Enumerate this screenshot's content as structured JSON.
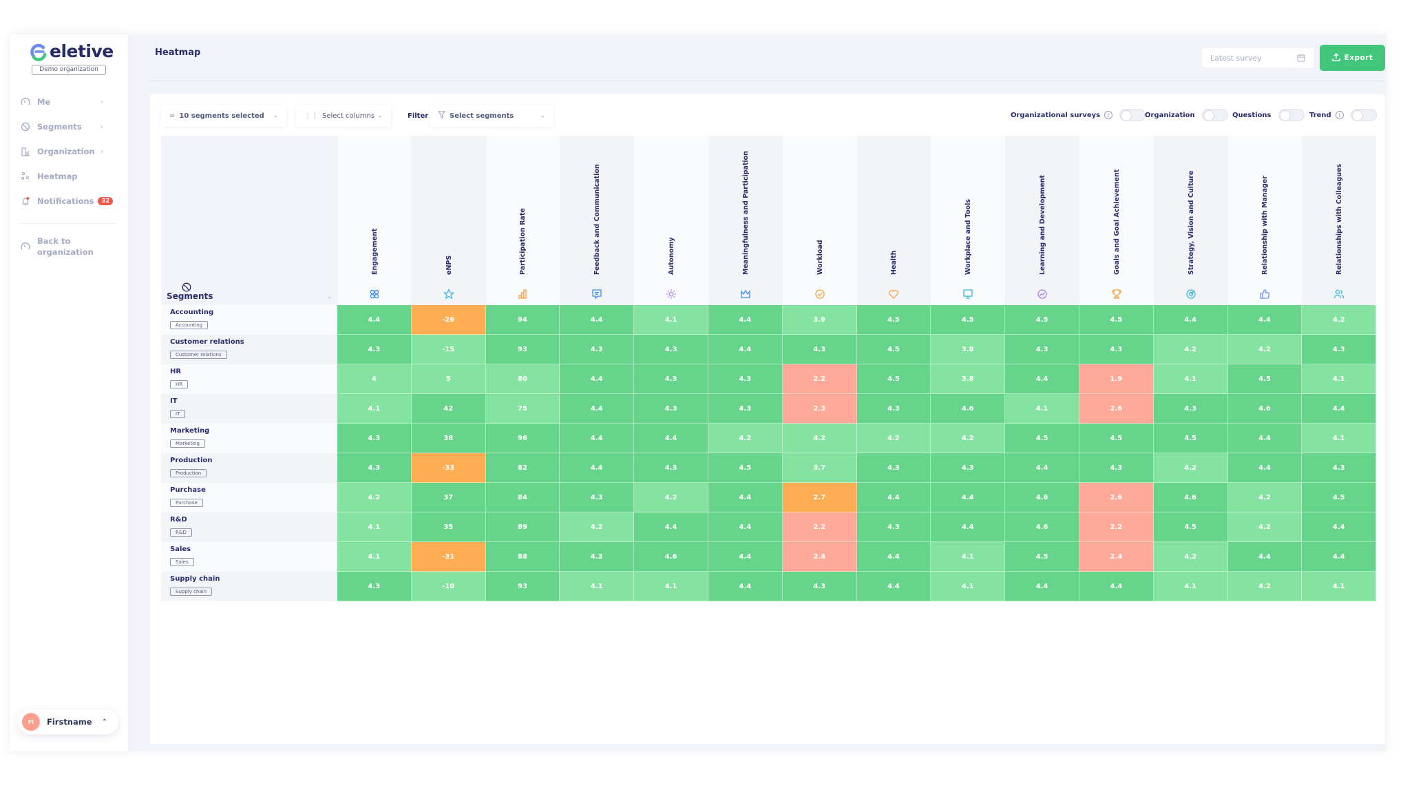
{
  "sidebar": {
    "brand": "eletive",
    "organization": "Demo organization",
    "items": [
      {
        "label": "Me",
        "icon": "gauge-icon",
        "has_chevron": true
      },
      {
        "label": "Segments",
        "icon": "pie-chart-icon",
        "has_chevron": true
      },
      {
        "label": "Organization",
        "icon": "building-chart-icon",
        "has_chevron": true
      },
      {
        "label": "Heatmap",
        "icon": "dots-icon",
        "has_chevron": false
      },
      {
        "label": "Notifications",
        "icon": "bell-icon",
        "has_chevron": false,
        "badge": "32"
      }
    ],
    "back_line1": "Back to",
    "back_line2": "organization",
    "user": {
      "initials": "FI",
      "name": "Firstname"
    }
  },
  "header": {
    "title": "Heatmap",
    "survey_placeholder": "Latest survey",
    "export_label": "Export"
  },
  "toolbar": {
    "segments_selected": "10 segments selected",
    "select_columns": "Select columns",
    "filter_label": "Filter",
    "select_segments": "Select segments",
    "toggles": [
      {
        "label": "Organizational surveys",
        "info": true,
        "on": false
      },
      {
        "label": "Organization",
        "info": false,
        "on": false
      },
      {
        "label": "Questions",
        "info": false,
        "on": false
      },
      {
        "label": "Trend",
        "info": true,
        "on": false
      }
    ]
  },
  "colors": {
    "high": "#66d48a",
    "mid": "#84e3a0",
    "warn": "#ffad52",
    "low": "#ffa999",
    "accent": "#41c67c",
    "text": "#2a2d6b"
  },
  "chart_data": {
    "type": "heatmap",
    "title": "Heatmap",
    "row_header": "Segments",
    "columns": [
      {
        "label": "Engagement",
        "icon": "engagement-icon"
      },
      {
        "label": "eNPS",
        "icon": "star-icon"
      },
      {
        "label": "Participation Rate",
        "icon": "bar-chart-icon"
      },
      {
        "label": "Feedback and Communication",
        "icon": "chat-icon"
      },
      {
        "label": "Autonomy",
        "icon": "sun-icon"
      },
      {
        "label": "Meaningfulness and Participation",
        "icon": "crown-icon"
      },
      {
        "label": "Workload",
        "icon": "check-circle-icon"
      },
      {
        "label": "Health",
        "icon": "heart-icon"
      },
      {
        "label": "Workplace and Tools",
        "icon": "monitor-icon"
      },
      {
        "label": "Learning and Development",
        "icon": "trend-circle-icon"
      },
      {
        "label": "Goals and Goal Achievement",
        "icon": "trophy-icon"
      },
      {
        "label": "Strategy, Vision and Culture",
        "icon": "target-icon"
      },
      {
        "label": "Relationship with Manager",
        "icon": "thumbs-up-icon"
      },
      {
        "label": "Relationships with Colleagues",
        "icon": "people-icon"
      }
    ],
    "rows": [
      {
        "segment": "Accounting",
        "tag": "Accounting",
        "values": [
          "4.4",
          "-26",
          "94",
          "4.4",
          "4.1",
          "4.4",
          "3.9",
          "4.5",
          "4.5",
          "4.5",
          "4.5",
          "4.4",
          "4.4",
          "4.2"
        ],
        "levels": [
          "high",
          "warn",
          "high",
          "high",
          "mid",
          "high",
          "mid",
          "high",
          "high",
          "high",
          "high",
          "high",
          "high",
          "mid"
        ]
      },
      {
        "segment": "Customer relations",
        "tag": "Customer relations",
        "values": [
          "4.3",
          "-15",
          "93",
          "4.3",
          "4.3",
          "4.4",
          "4.3",
          "4.5",
          "3.8",
          "4.3",
          "4.3",
          "4.2",
          "4.2",
          "4.3"
        ],
        "levels": [
          "high",
          "mid",
          "high",
          "high",
          "high",
          "high",
          "high",
          "high",
          "mid",
          "high",
          "high",
          "mid",
          "mid",
          "high"
        ]
      },
      {
        "segment": "HR",
        "tag": "HR",
        "values": [
          "4",
          "5",
          "80",
          "4.4",
          "4.3",
          "4.3",
          "2.2",
          "4.5",
          "3.8",
          "4.4",
          "1.9",
          "4.1",
          "4.5",
          "4.1"
        ],
        "levels": [
          "mid",
          "mid",
          "mid",
          "high",
          "high",
          "high",
          "low",
          "high",
          "mid",
          "high",
          "low",
          "mid",
          "high",
          "mid"
        ]
      },
      {
        "segment": "IT",
        "tag": "IT",
        "values": [
          "4.1",
          "42",
          "75",
          "4.4",
          "4.3",
          "4.3",
          "2.3",
          "4.3",
          "4.6",
          "4.1",
          "2.6",
          "4.3",
          "4.6",
          "4.4"
        ],
        "levels": [
          "mid",
          "high",
          "mid",
          "high",
          "high",
          "high",
          "low",
          "high",
          "high",
          "mid",
          "low",
          "high",
          "high",
          "high"
        ]
      },
      {
        "segment": "Marketing",
        "tag": "Marketing",
        "values": [
          "4.3",
          "38",
          "96",
          "4.4",
          "4.4",
          "4.2",
          "4.2",
          "4.2",
          "4.2",
          "4.5",
          "4.5",
          "4.5",
          "4.4",
          "4.1"
        ],
        "levels": [
          "high",
          "high",
          "high",
          "high",
          "high",
          "mid",
          "mid",
          "mid",
          "mid",
          "high",
          "high",
          "high",
          "high",
          "mid"
        ]
      },
      {
        "segment": "Production",
        "tag": "Production",
        "values": [
          "4.3",
          "-33",
          "82",
          "4.4",
          "4.3",
          "4.5",
          "3.7",
          "4.3",
          "4.3",
          "4.4",
          "4.3",
          "4.2",
          "4.4",
          "4.3"
        ],
        "levels": [
          "high",
          "warn",
          "high",
          "high",
          "high",
          "high",
          "mid",
          "high",
          "high",
          "high",
          "high",
          "mid",
          "high",
          "high"
        ]
      },
      {
        "segment": "Purchase",
        "tag": "Purchase",
        "values": [
          "4.2",
          "37",
          "84",
          "4.3",
          "4.2",
          "4.4",
          "2.7",
          "4.4",
          "4.4",
          "4.6",
          "2.6",
          "4.6",
          "4.2",
          "4.5"
        ],
        "levels": [
          "mid",
          "high",
          "high",
          "high",
          "mid",
          "high",
          "warn",
          "high",
          "high",
          "high",
          "low",
          "high",
          "mid",
          "high"
        ]
      },
      {
        "segment": "R&D",
        "tag": "R&D",
        "values": [
          "4.1",
          "35",
          "89",
          "4.2",
          "4.4",
          "4.4",
          "2.2",
          "4.3",
          "4.4",
          "4.6",
          "2.2",
          "4.5",
          "4.2",
          "4.4"
        ],
        "levels": [
          "mid",
          "high",
          "high",
          "mid",
          "high",
          "high",
          "low",
          "high",
          "high",
          "high",
          "low",
          "high",
          "mid",
          "high"
        ]
      },
      {
        "segment": "Sales",
        "tag": "Sales",
        "values": [
          "4.1",
          "-31",
          "88",
          "4.3",
          "4.6",
          "4.4",
          "2.4",
          "4.4",
          "4.1",
          "4.5",
          "2.4",
          "4.2",
          "4.4",
          "4.4"
        ],
        "levels": [
          "mid",
          "warn",
          "high",
          "high",
          "high",
          "high",
          "low",
          "high",
          "mid",
          "high",
          "low",
          "mid",
          "high",
          "high"
        ]
      },
      {
        "segment": "Supply chain",
        "tag": "Supply chain",
        "values": [
          "4.3",
          "-10",
          "93",
          "4.1",
          "4.1",
          "4.4",
          "4.3",
          "4.4",
          "4.1",
          "4.4",
          "4.4",
          "4.1",
          "4.2",
          "4.1"
        ],
        "levels": [
          "high",
          "mid",
          "high",
          "mid",
          "mid",
          "high",
          "high",
          "high",
          "mid",
          "high",
          "high",
          "mid",
          "mid",
          "mid"
        ]
      }
    ]
  }
}
